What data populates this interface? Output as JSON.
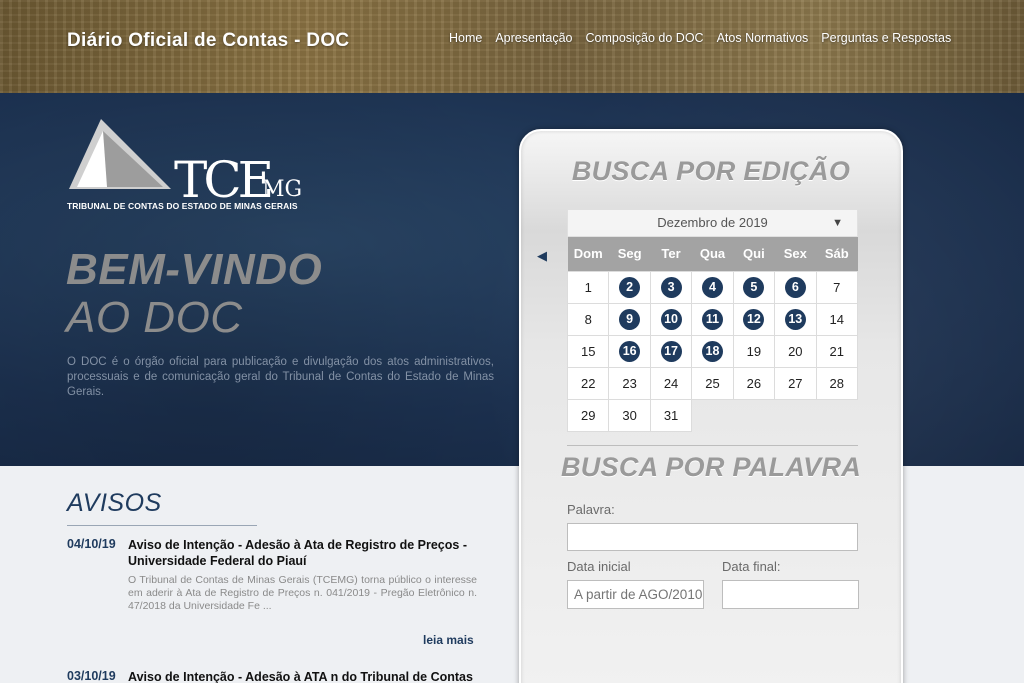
{
  "header": {
    "site_title": "Diário Oficial de Contas - DOC",
    "nav": [
      "Home",
      "Apresentação",
      "Composição do DOC",
      "Atos Normativos",
      "Perguntas e Respostas"
    ]
  },
  "hero": {
    "logo_text": "TCE",
    "logo_suffix": "MG",
    "logo_caption": "TRIBUNAL DE CONTAS DO ESTADO DE MINAS GERAIS",
    "welcome_line1": "BEM-VINDO",
    "welcome_line2": "AO DOC",
    "intro": "O DOC é o órgão oficial para publicação e divulgação dos atos administrativos, processuais e de comunicação geral do Tribunal de Contas do Estado de Minas Gerais."
  },
  "avisos": {
    "title": "AVISOS",
    "items": [
      {
        "date": "04/10/19",
        "headline": "Aviso de Intenção - Adesão à Ata de Registro de Preços - Universidade Federal do Piauí",
        "body": "O Tribunal de Contas de Minas Gerais (TCEMG) torna público o interesse em aderir à Ata de Registro de Preços n. 041/2019 - Pregão Eletrônico n. 47/2018 da Universidade Fe ...",
        "more": "leia mais"
      },
      {
        "date": "03/10/19",
        "headline": "Aviso de Intenção - Adesão à ATA n do Tribunal de Contas do"
      }
    ]
  },
  "search": {
    "edition_title": "BUSCA POR EDIÇÃO",
    "month": "Dezembro de 2019",
    "prev_icon": "◀",
    "month_icon": "▼",
    "weekdays": [
      "Dom",
      "Seg",
      "Ter",
      "Qua",
      "Qui",
      "Sex",
      "Sáb"
    ],
    "weeks": [
      [
        "1",
        "2",
        "3",
        "4",
        "5",
        "6",
        "7"
      ],
      [
        "8",
        "9",
        "10",
        "11",
        "12",
        "13",
        "14"
      ],
      [
        "15",
        "16",
        "17",
        "18",
        "19",
        "20",
        "21"
      ],
      [
        "22",
        "23",
        "24",
        "25",
        "26",
        "27",
        "28"
      ],
      [
        "29",
        "30",
        "31",
        "",
        "",
        "",
        ""
      ]
    ],
    "highlighted_days": [
      "2",
      "3",
      "4",
      "5",
      "6",
      "9",
      "10",
      "11",
      "12",
      "13",
      "16",
      "17",
      "18"
    ],
    "word_title": "BUSCA POR PALAVRA",
    "word_label": "Palavra:",
    "word_value": "",
    "start_label": "Data inicial",
    "start_placeholder": "A partir de AGO/2010",
    "end_label": "Data final:",
    "end_value": ""
  },
  "colors": {
    "navy": "#1f3b5e",
    "header_gold": "#8c7444",
    "hero_blue": "#1c3150"
  }
}
